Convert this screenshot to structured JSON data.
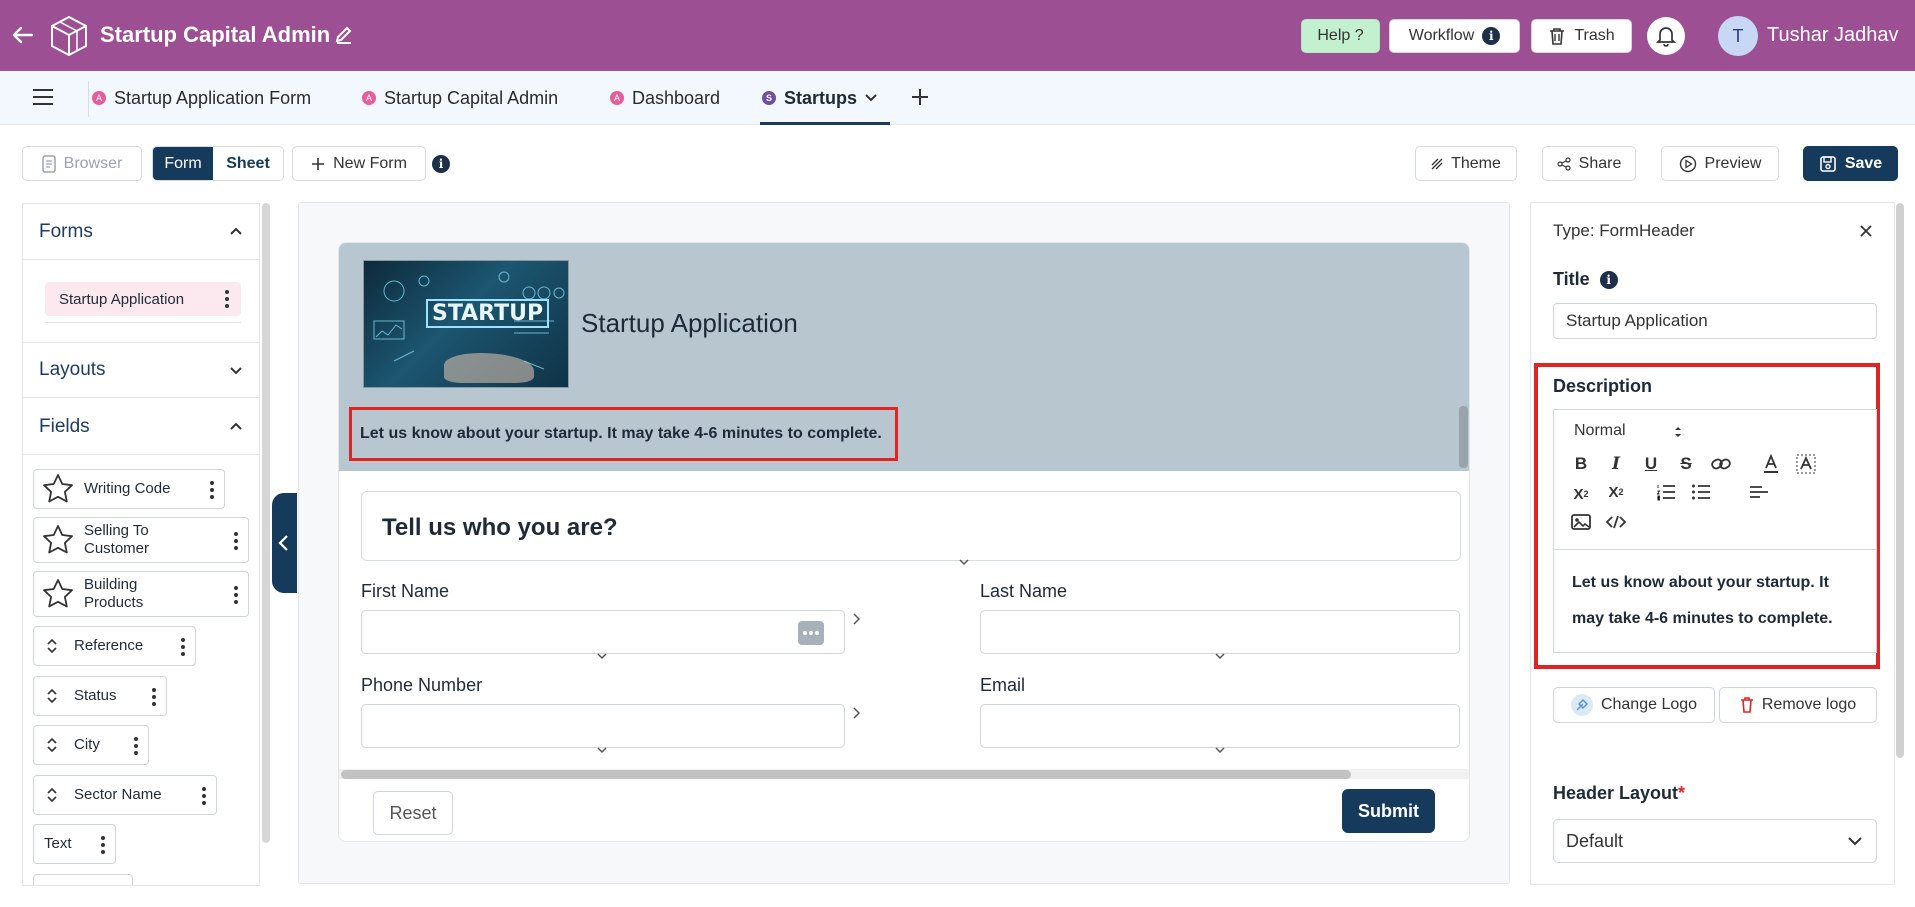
{
  "app": {
    "title": "Startup Capital Admin",
    "help_label": "Help ?",
    "workflow_label": "Workflow",
    "trash_label": "Trash",
    "user_initial": "T",
    "user_name": "Tushar Jadhav"
  },
  "tabs": [
    {
      "label": "Startup Application Form",
      "badge": "A"
    },
    {
      "label": "Startup Capital Admin",
      "badge": "A"
    },
    {
      "label": "Dashboard",
      "badge": "A"
    },
    {
      "label": "Startups",
      "badge": "S",
      "active": true
    }
  ],
  "toolbar": {
    "browser_label": "Browser",
    "form_label": "Form",
    "sheet_label": "Sheet",
    "new_form_label": "New Form",
    "theme_label": "Theme",
    "share_label": "Share",
    "preview_label": "Preview",
    "save_label": "Save"
  },
  "left_panel": {
    "forms_header": "Forms",
    "form_item": "Startup Application",
    "layouts_header": "Layouts",
    "fields_header": "Fields",
    "fields": [
      {
        "label": "Writing Code",
        "icon": "star-icon"
      },
      {
        "label": "Selling To Customer",
        "icon": "star-icon"
      },
      {
        "label": "Building Products",
        "icon": "star-icon"
      },
      {
        "label": "Reference",
        "icon": "sort-icon"
      },
      {
        "label": "Status",
        "icon": "sort-icon"
      },
      {
        "label": "City",
        "icon": "sort-icon"
      },
      {
        "label": "Sector Name",
        "icon": "sort-icon"
      },
      {
        "label": "Text",
        "icon": ""
      }
    ]
  },
  "form": {
    "header_image_text": "STARTUP",
    "title": "Startup Application",
    "description": "Let us know about your startup. It may take 4-6 minutes to complete.",
    "section_title": "Tell us who you are?",
    "first_name_label": "First Name",
    "last_name_label": "Last Name",
    "phone_label": "Phone Number",
    "email_label": "Email",
    "reset_label": "Reset",
    "submit_label": "Submit"
  },
  "right_panel": {
    "type_label": "Type: FormHeader",
    "title_label": "Title",
    "title_value": "Startup Application",
    "description_label": "Description",
    "format_value": "Normal",
    "description_value": "Let us know about your startup. It may take 4-6 minutes to complete.",
    "change_logo_label": "Change Logo",
    "remove_logo_label": "Remove logo",
    "header_layout_label": "Header Layout",
    "header_layout_value": "Default"
  },
  "colors": {
    "topbar": "#9c4f93",
    "primary": "#163a5c",
    "highlight": "#e02424"
  }
}
